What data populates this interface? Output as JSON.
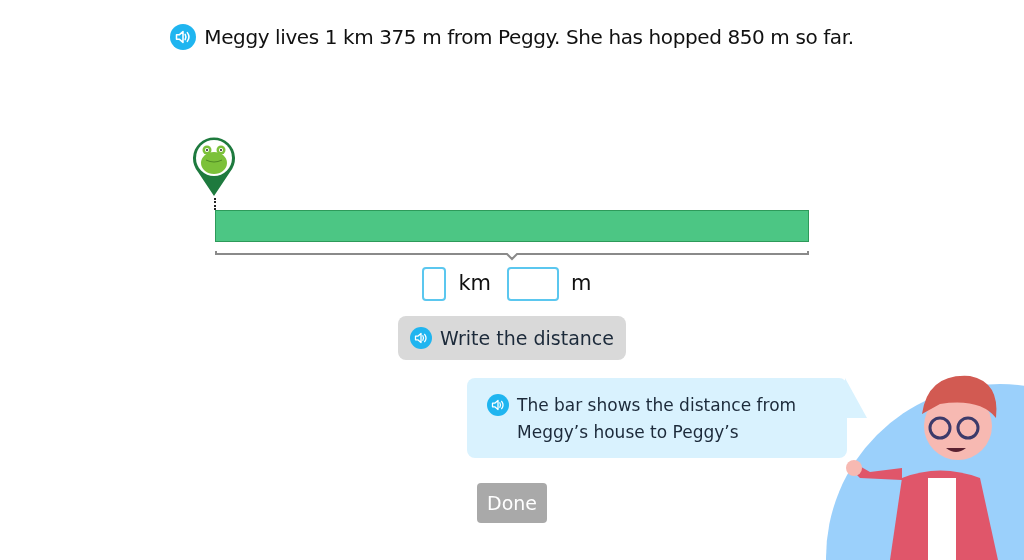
{
  "question": {
    "text": "Meggy lives 1 km 375 m from Peggy. She has hopped 850 m so far."
  },
  "answer": {
    "fields": [
      {
        "unit": "km"
      },
      {
        "unit": "m"
      }
    ]
  },
  "instruction_button": {
    "label": "Write the distance"
  },
  "speech_bubble": {
    "text": "The bar shows the distance from Meggy’s house to Peggy’s"
  },
  "done_button": {
    "label": "Done",
    "disabled": true
  }
}
